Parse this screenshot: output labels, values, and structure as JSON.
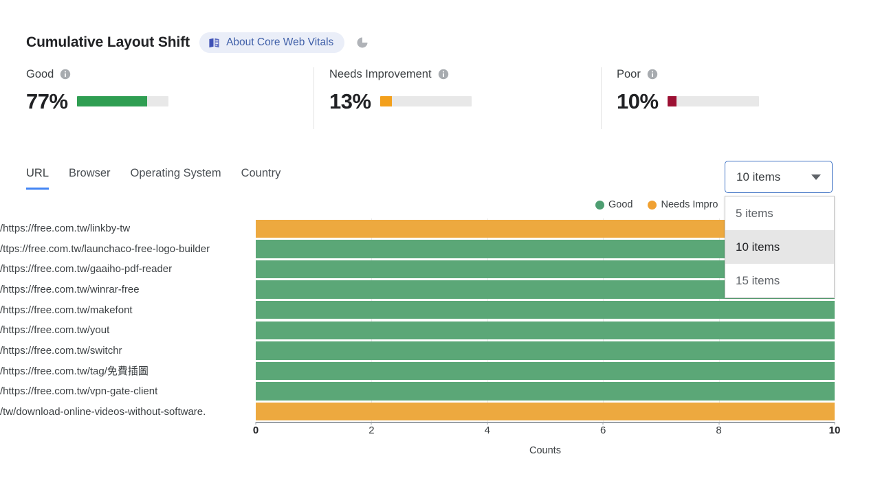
{
  "header": {
    "title": "Cumulative Layout Shift",
    "about_link_label": "About Core Web Vitals",
    "book_icon": "book-icon",
    "pie_icon": "pie-chart-icon"
  },
  "metrics": [
    {
      "label": "Good",
      "value": "77%",
      "percent": 77,
      "color": "#2f9e52",
      "info_icon": "info-icon"
    },
    {
      "label": "Needs Improvement",
      "value": "13%",
      "percent": 13,
      "color": "#f3a01c",
      "info_icon": "info-icon"
    },
    {
      "label": "Poor",
      "value": "10%",
      "percent": 10,
      "color": "#9c1033",
      "info_icon": "info-icon"
    }
  ],
  "tabs": [
    {
      "label": "URL",
      "active": true
    },
    {
      "label": "Browser",
      "active": false
    },
    {
      "label": "Operating System",
      "active": false
    },
    {
      "label": "Country",
      "active": false
    }
  ],
  "items_select": {
    "value": "10 items",
    "caret_icon": "chevron-down-icon",
    "expanded": true,
    "options": [
      {
        "label": "5 items",
        "selected": false
      },
      {
        "label": "10 items",
        "selected": true
      },
      {
        "label": "15 items",
        "selected": false
      }
    ]
  },
  "legend": [
    {
      "label": "Good",
      "color": "#4e9e72"
    },
    {
      "label": "Needs Impro",
      "color": "#f0a132"
    }
  ],
  "chart_data": {
    "type": "bar",
    "orientation": "horizontal",
    "title": "",
    "xlabel": "Counts",
    "ylabel": "",
    "xlim": [
      0,
      10
    ],
    "xticks": [
      0,
      2,
      4,
      6,
      8,
      10
    ],
    "grid": true,
    "legend_position": "top-right",
    "categories": [
      "https://free.com.tw/linkby-tw/",
      "ttps://free.com.tw/launchaco-free-logo-builder/",
      "https://free.com.tw/gaaiho-pdf-reader/",
      "https://free.com.tw/winrar-free/",
      "https://free.com.tw/makefont/",
      "https://free.com.tw/yout/",
      "https://free.com.tw/switchr/",
      "https://free.com.tw/tag/免費插圖/",
      "https://free.com.tw/vpn-gate-client/",
      ".tw/download-online-videos-without-software/"
    ],
    "values": [
      10,
      10,
      10,
      10,
      10,
      10,
      10,
      10,
      10,
      10
    ],
    "bar_categories": [
      "Needs Improvement",
      "Good",
      "Good",
      "Good",
      "Good",
      "Good",
      "Good",
      "Good",
      "Good",
      "Needs Improvement"
    ],
    "colors": {
      "Good": "#5ba777",
      "Needs Improvement": "#eda93f"
    }
  }
}
